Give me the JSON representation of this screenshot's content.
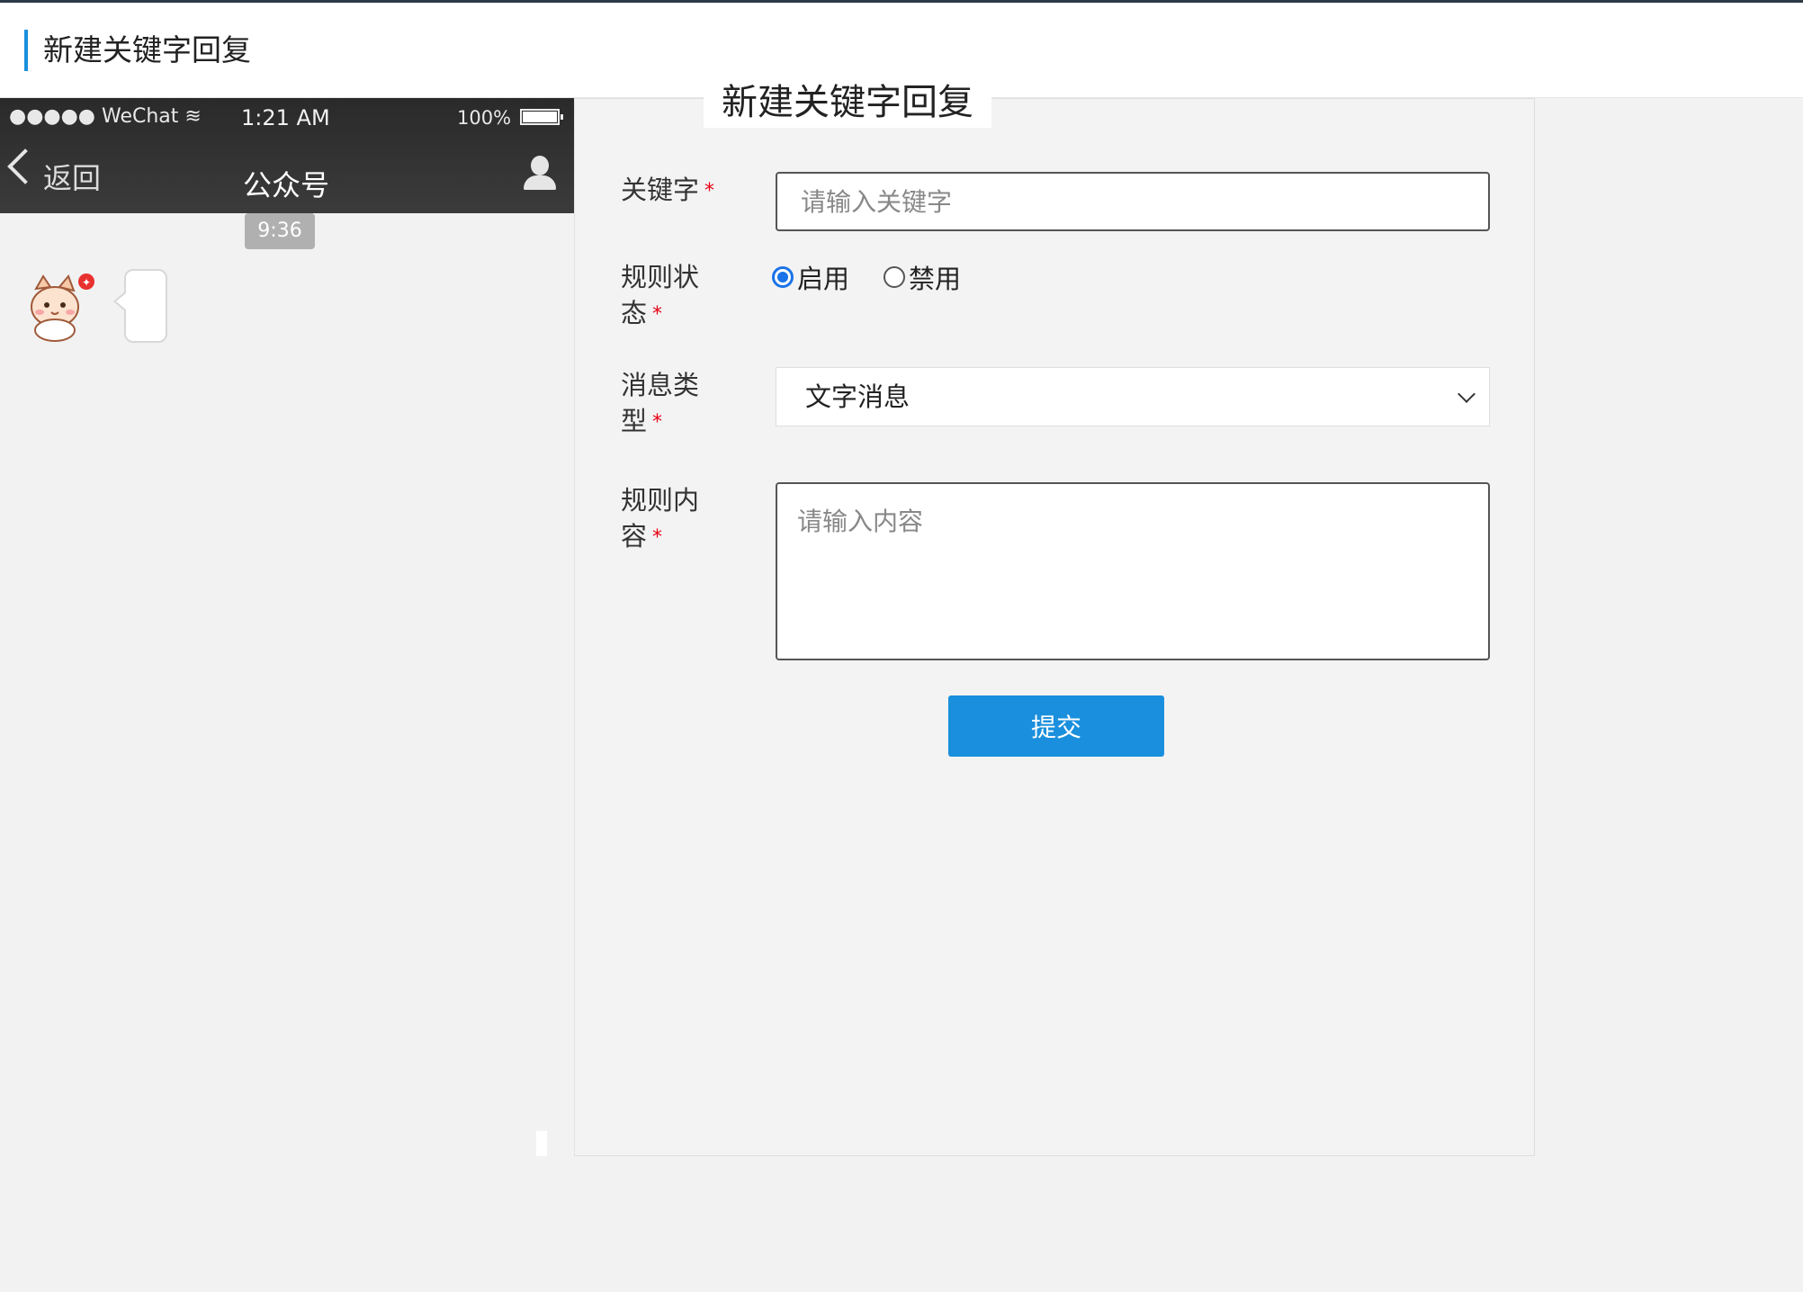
{
  "header": {
    "title": "新建关键字回复"
  },
  "phone": {
    "status": {
      "carrier": "●●●●● WeChat ",
      "time": "1:21 AM",
      "battery": "100%"
    },
    "nav": {
      "back_label": "返回",
      "account_name": "公众号"
    },
    "message_time": "9:36"
  },
  "form": {
    "legend": "新建关键字回复",
    "required_mark": "*",
    "keyword": {
      "label": "关键字",
      "placeholder": "请输入关键字",
      "value": ""
    },
    "status": {
      "label_line1": "规则状",
      "label_line2": "态",
      "options": [
        {
          "label": "启用",
          "selected": true
        },
        {
          "label": "禁用",
          "selected": false
        }
      ]
    },
    "message_type": {
      "label_line1": "消息类",
      "label_line2": "型",
      "value": "文字消息"
    },
    "content": {
      "label_line1": "规则内",
      "label_line2": "容",
      "placeholder": "请输入内容",
      "value": ""
    },
    "submit_label": "提交"
  },
  "colors": {
    "accent": "#1a8fdd",
    "required": "#e60012",
    "radio_selected": "#1a73e8"
  }
}
